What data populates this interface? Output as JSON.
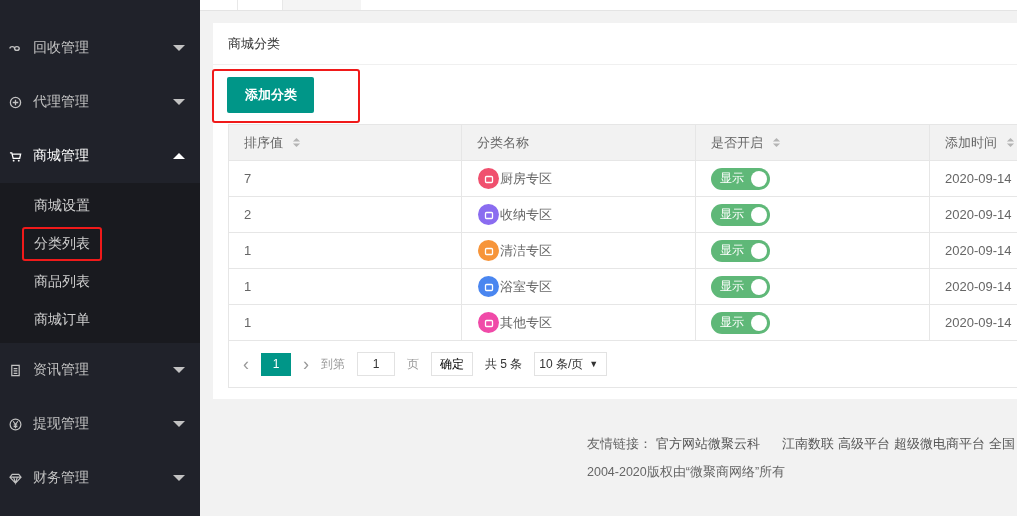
{
  "sidebar": {
    "items": [
      {
        "label": "回收管理",
        "expanded": false
      },
      {
        "label": "代理管理",
        "expanded": false
      },
      {
        "label": "商城管理",
        "expanded": true,
        "children": [
          {
            "label": "商城设置",
            "highlighted": false
          },
          {
            "label": "分类列表",
            "highlighted": true
          },
          {
            "label": "商品列表",
            "highlighted": false
          },
          {
            "label": "商城订单",
            "highlighted": false
          }
        ]
      },
      {
        "label": "资讯管理",
        "expanded": false
      },
      {
        "label": "提现管理",
        "expanded": false
      },
      {
        "label": "财务管理",
        "expanded": false
      }
    ]
  },
  "card": {
    "title": "商城分类",
    "add_button": {
      "label": "添加分类",
      "highlighted": true
    },
    "table": {
      "columns": [
        {
          "label": "排序值",
          "sortable": true
        },
        {
          "label": "分类名称",
          "sortable": false
        },
        {
          "label": "是否开启",
          "sortable": true
        },
        {
          "label": "添加时间",
          "sortable": true
        }
      ],
      "rows": [
        {
          "sort": "7",
          "name": "厨房专区",
          "color": "#f0506e",
          "enabled": true,
          "toggle_label": "显示",
          "time": "2020-09-14"
        },
        {
          "sort": "2",
          "name": "收纳专区",
          "color": "#8a6cf0",
          "enabled": true,
          "toggle_label": "显示",
          "time": "2020-09-14"
        },
        {
          "sort": "1",
          "name": "清洁专区",
          "color": "#f7953a",
          "enabled": true,
          "toggle_label": "显示",
          "time": "2020-09-14"
        },
        {
          "sort": "1",
          "name": "浴室专区",
          "color": "#4a86f0",
          "enabled": true,
          "toggle_label": "显示",
          "time": "2020-09-14"
        },
        {
          "sort": "1",
          "name": "其他专区",
          "color": "#f04aa8",
          "enabled": true,
          "toggle_label": "显示",
          "time": "2020-09-14"
        }
      ]
    },
    "pagination": {
      "prev": "‹",
      "page": "1",
      "next": "›",
      "goto_label": "到第",
      "goto_value": "1",
      "page_unit": "页",
      "confirm": "确定",
      "total": "共 5 条",
      "page_size": "10 条/页",
      "dropdown": "▼"
    }
  },
  "footer": {
    "links_label": "友情链接：",
    "links": [
      "官方网站微聚云科",
      "江南数联",
      "高级平台",
      "超级微电商平台",
      "全国"
    ],
    "copyright": "2004-2020版权由“微聚商网络”所有"
  }
}
